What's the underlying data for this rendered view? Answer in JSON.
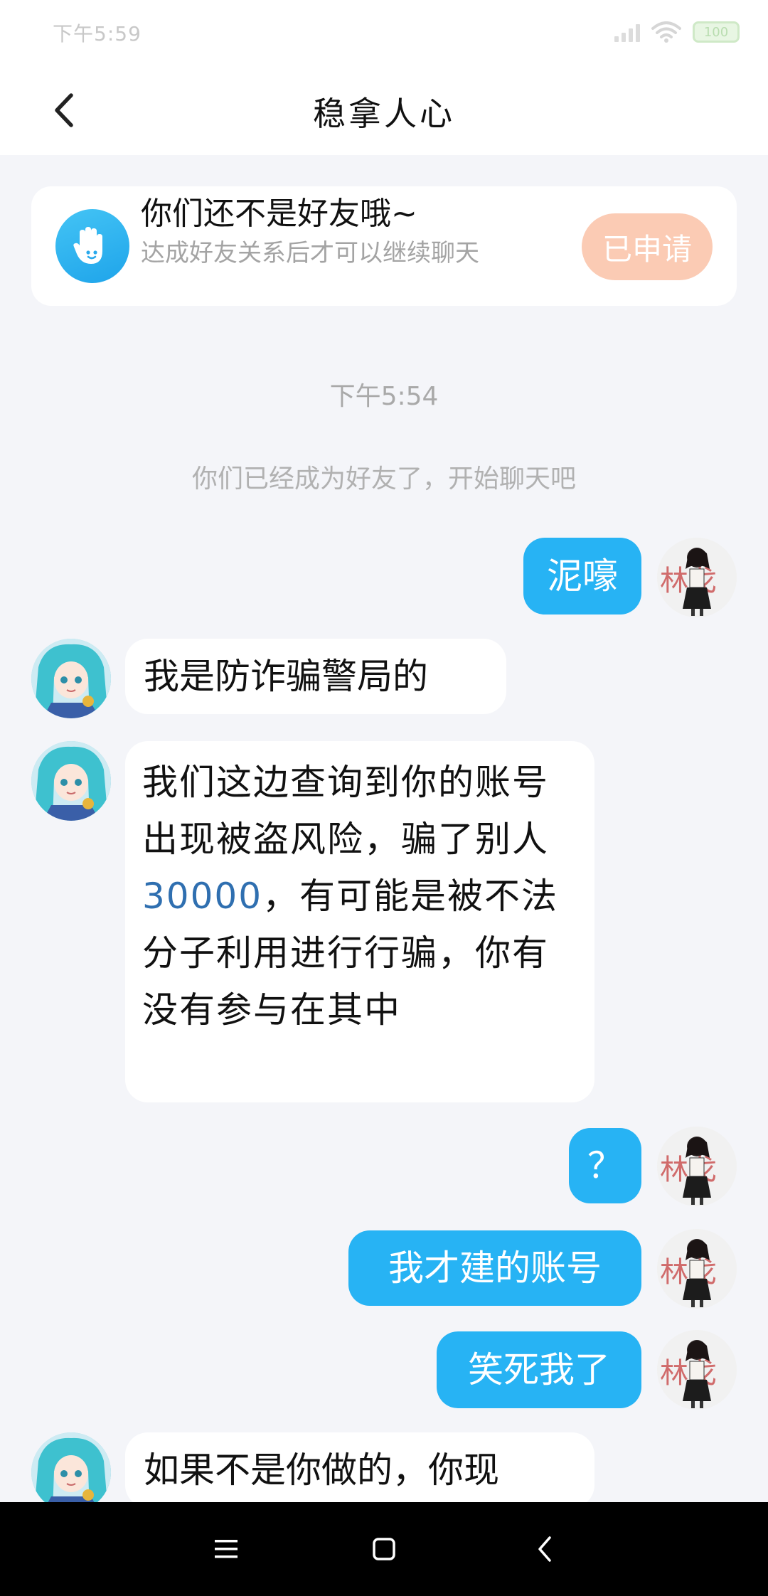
{
  "status_bar": {
    "time": "下午5:59",
    "battery": "100"
  },
  "header": {
    "title": "稳拿人心"
  },
  "notice": {
    "title": "你们还不是好友哦~",
    "description": "达成好友关系后才可以继续聊天",
    "applied_label": "已申请"
  },
  "chat": {
    "time_stamp": "下午5:54",
    "system_message": "你们已经成为好友了，开始聊天吧",
    "messages": [
      {
        "from": "me",
        "text": "泥嚎"
      },
      {
        "from": "other",
        "text": "我是防诈骗警局的"
      },
      {
        "from": "other",
        "text_before": "我们这边查询到你的账号出现被盗风险，骗了别人",
        "amount": "30000",
        "text_after": "，有可能是被不法分子利用进行行骗，你有没有参与在其中"
      },
      {
        "from": "me",
        "text": "？"
      },
      {
        "from": "me",
        "text": "我才建的账号"
      },
      {
        "from": "me",
        "text": "笑死我了"
      },
      {
        "from": "other",
        "text": "如果不是你做的，你现"
      }
    ]
  },
  "colors": {
    "accent": "#27b3f4",
    "applied_button": "#fbcbb4",
    "link": "#2f6fb0",
    "background": "#f4f5f9"
  },
  "icons": {
    "back": "chevron-left-icon",
    "notice": "hand-wave-icon",
    "nav_menu": "menu-icon",
    "nav_home": "square-icon",
    "nav_back": "back-arrow-icon"
  }
}
